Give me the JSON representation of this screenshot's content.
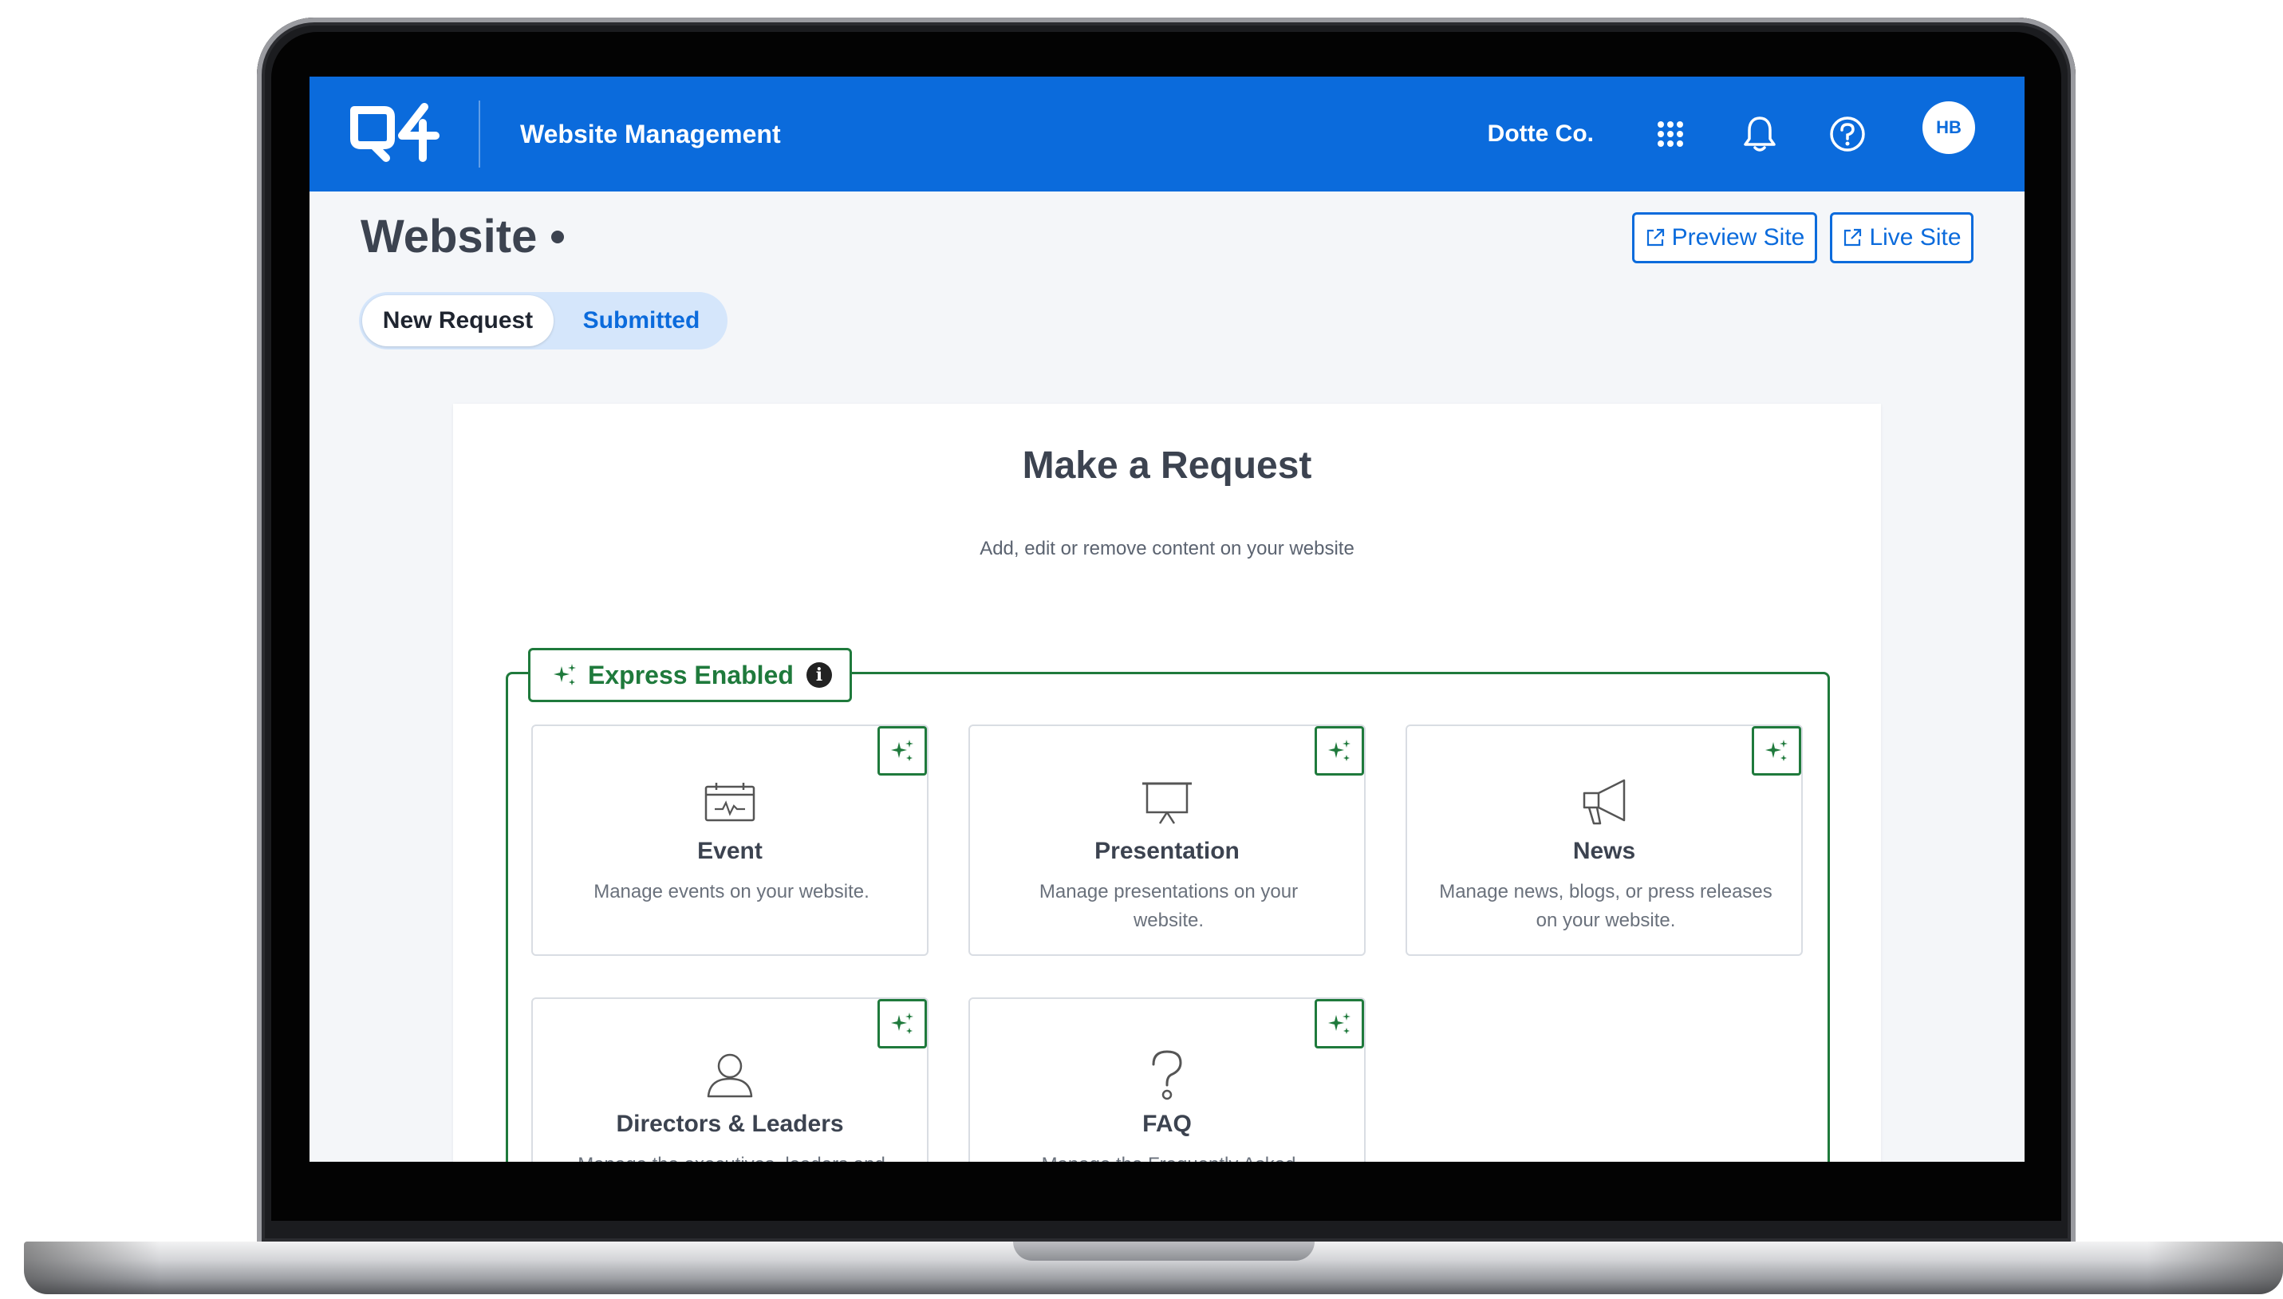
{
  "app": {
    "title": "Website Management",
    "company": "Dotte Co.",
    "user_initials": "HB"
  },
  "topbar_icons": [
    {
      "icon": "apps-grid-icon"
    },
    {
      "icon": "bell-icon"
    },
    {
      "icon": "help-icon"
    }
  ],
  "page": {
    "title": "Website",
    "preview_label": "Preview Site",
    "live_label": "Live Site"
  },
  "tabs": [
    {
      "label": "New Request",
      "active": true
    },
    {
      "label": "Submitted",
      "active": false
    }
  ],
  "request": {
    "title": "Make a Request",
    "subtitle": "Add, edit or remove content on your website",
    "express_label": "Express Enabled"
  },
  "cards": [
    {
      "title": "Event",
      "description": "Manage events on your website.",
      "icon": "calendar-icon"
    },
    {
      "title": "Presentation",
      "description": "Manage presentations on your website.",
      "icon": "presentation-board-icon"
    },
    {
      "title": "News",
      "description": "Manage news, blogs, or press releases on your website.",
      "icon": "megaphone-icon"
    },
    {
      "title": "Directors & Leaders",
      "description": "Manage the executives, leaders and directors on your website.",
      "icon": "person-icon"
    },
    {
      "title": "FAQ",
      "description": "Manage the Frequently Asked Questions on your website.",
      "icon": "question-icon"
    }
  ],
  "colors": {
    "brand_blue": "#0b6bdc",
    "express_green": "#1f7a3c",
    "page_background": "#f4f6f9"
  }
}
